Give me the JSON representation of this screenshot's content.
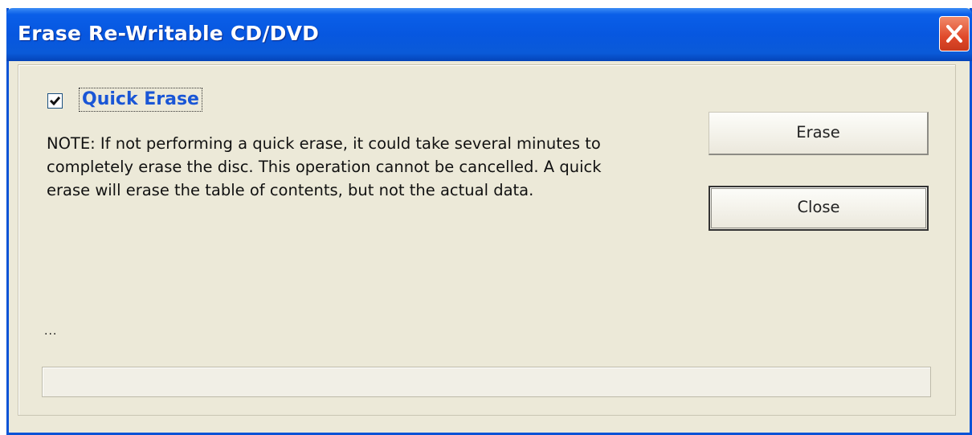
{
  "window": {
    "title": "Erase Re-Writable CD/DVD"
  },
  "options": {
    "quick_erase_label": "Quick Erase",
    "quick_erase_checked": true
  },
  "note": "NOTE: If not performing a quick erase, it could take several minutes to\ncompletely erase the disc. This operation cannot be cancelled. A quick\nerase will erase the table of contents, but not the actual data.",
  "buttons": {
    "erase_label": "Erase",
    "close_label": "Close"
  },
  "status": {
    "text": "...",
    "progress": 0
  },
  "colors": {
    "titlebar": "#0757e0",
    "window_bg": "#ece9d8",
    "link_label": "#1a56d6",
    "close_button": "#e0492a"
  },
  "icons": {
    "close": "close-icon",
    "check": "checkmark-icon"
  }
}
